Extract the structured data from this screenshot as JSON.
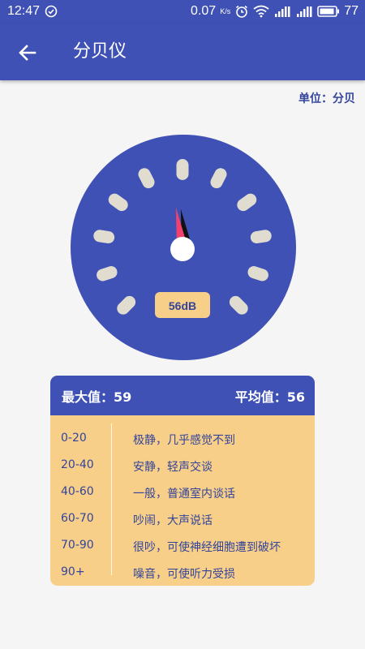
{
  "status_bar": {
    "time": "12:47",
    "speed": "0.07",
    "speed_unit": "K/s",
    "battery": "77"
  },
  "app_bar": {
    "back_icon": "arrow-left-icon",
    "title": "分贝仪"
  },
  "unit_label": "单位：分贝",
  "gauge": {
    "reading": "56dB",
    "value_db": 56,
    "max_db": 120,
    "colors": {
      "dial": "#3f51b5",
      "ticks": "#e0ddd0",
      "needle": "#f2416e",
      "needle_shadow": "#111111",
      "readout_bg": "#f7cf89"
    }
  },
  "stats": {
    "max_label": "最大值：59",
    "avg_label": "平均值：56",
    "rows": [
      {
        "range": "0-20",
        "desc": "极静，几乎感觉不到"
      },
      {
        "range": "20-40",
        "desc": "安静，轻声交谈"
      },
      {
        "range": "40-60",
        "desc": "一般，普通室内谈话"
      },
      {
        "range": "60-70",
        "desc": "吵闹，大声说话"
      },
      {
        "range": "70-90",
        "desc": "很吵，可使神经细胞遭到破坏"
      },
      {
        "range": "90+",
        "desc": "噪音，可使听力受损"
      }
    ]
  }
}
